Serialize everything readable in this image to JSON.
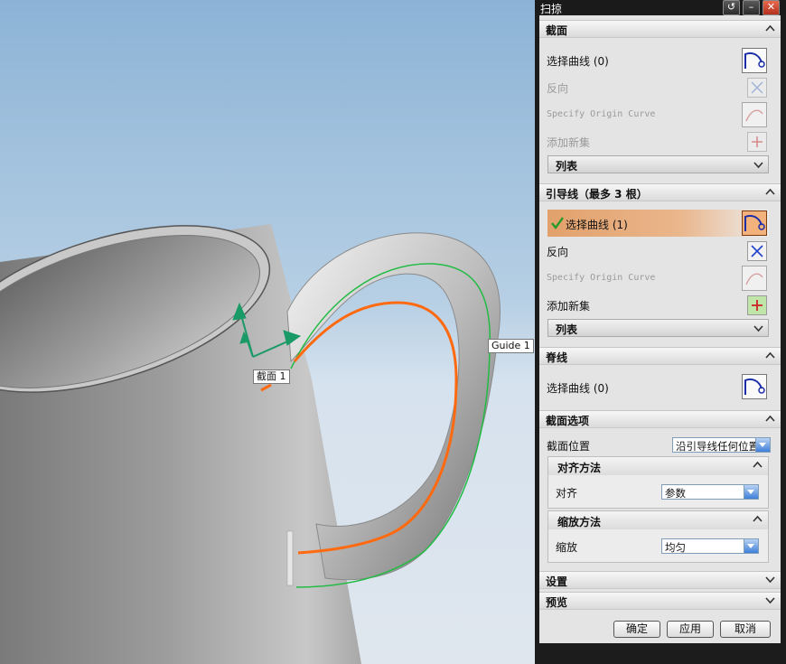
{
  "viewport": {
    "section_tag": "截面 1",
    "guide_tag": "Guide 1",
    "colors": {
      "guide_curve": "#22bb44",
      "section_curve": "#ff6a10",
      "csys_axis": "#1a9a66"
    }
  },
  "dialog": {
    "title": "扫掠",
    "title_buttons": [
      "reset-icon",
      "minimize-icon",
      "close-icon"
    ],
    "section": {
      "header": "截面",
      "select_curve": "选择曲线 (0)",
      "reverse": "反向",
      "specify_origin": "Specify Origin Curve",
      "add_new_set": "添加新集",
      "list": "列表"
    },
    "guide": {
      "header": "引导线（最多 3 根）",
      "select_curve": "选择曲线 (1)",
      "reverse": "反向",
      "specify_origin": "Specify Origin Curve",
      "add_new_set": "添加新集",
      "list": "列表"
    },
    "spine": {
      "header": "脊线",
      "select_curve": "选择曲线 (0)"
    },
    "section_options": {
      "header": "截面选项",
      "position_label": "截面位置",
      "position_value": "沿引导线任何位置",
      "alignment": {
        "header": "对齐方法",
        "label": "对齐",
        "value": "参数"
      },
      "scaling": {
        "header": "缩放方法",
        "label": "缩放",
        "value": "均匀"
      }
    },
    "settings": {
      "header": "设置"
    },
    "preview": {
      "header": "预览"
    },
    "buttons": {
      "ok": "确定",
      "apply": "应用",
      "cancel": "取消"
    },
    "colors": {
      "highlight": "#f3b27c",
      "check": "#2a9a2a"
    }
  }
}
